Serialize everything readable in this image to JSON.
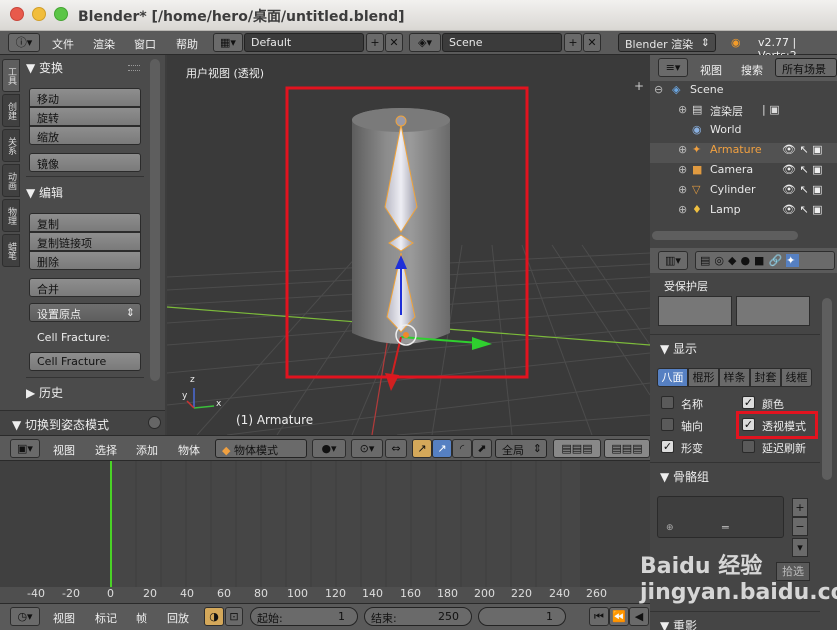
{
  "window": {
    "title": "Blender* [/home/hero/桌面/untitled.blend]"
  },
  "topbar": {
    "menus": [
      "文件",
      "渲染",
      "窗口",
      "帮助"
    ],
    "layout": "Default",
    "scene": "Scene",
    "engine": "Blender 渲染",
    "version": "v2.77 | Verts:2"
  },
  "toolshelf": {
    "tabs": [
      "工具",
      "创建",
      "关系",
      "动画",
      "物理",
      "蜡笔"
    ],
    "transform": {
      "title": "变换",
      "buttons": [
        "移动",
        "旋转",
        "缩放"
      ],
      "mirror": "镜像"
    },
    "edit": {
      "title": "编辑",
      "buttons": [
        "复制",
        "复制链接项",
        "删除"
      ],
      "join": "合并",
      "origin": "设置原点",
      "fracture_label": "Cell Fracture:",
      "fracture_btn": "Cell Fracture"
    },
    "history": {
      "title": "历史"
    },
    "operator": "切换到姿态模式"
  },
  "viewport": {
    "label": "用户视图 (透视)",
    "object": "(1) Armature",
    "axis_x": "x",
    "axis_y": "y",
    "axis_z": "z"
  },
  "viewheader": {
    "menus": [
      "视图",
      "选择",
      "添加",
      "物体"
    ],
    "mode": "物体模式",
    "pivot": "全局"
  },
  "timeline": {
    "ticks": [
      "-40",
      "-20",
      "0",
      "20",
      "40",
      "60",
      "80",
      "100",
      "120",
      "140",
      "160",
      "180",
      "200",
      "220",
      "240",
      "260"
    ],
    "footer_menus": [
      "视图",
      "标记",
      "帧",
      "回放"
    ],
    "start_label": "起始:",
    "start": "1",
    "end_label": "结束:",
    "end": "250",
    "current": "1"
  },
  "outliner": {
    "menus": [
      "视图",
      "搜索"
    ],
    "filter": "所有场景",
    "items": [
      {
        "name": "Scene"
      },
      {
        "name": "渲染层"
      },
      {
        "name": "World"
      },
      {
        "name": "Armature"
      },
      {
        "name": "Camera"
      },
      {
        "name": "Cylinder"
      },
      {
        "name": "Lamp"
      }
    ]
  },
  "properties": {
    "protected": "受保护层",
    "display": {
      "title": "显示",
      "tabs": [
        "八面",
        "棍形",
        "样条",
        "封套",
        "线框"
      ],
      "name": "名称",
      "color": "颜色",
      "axes": "轴向",
      "xray": "透视模式",
      "shape": "形变",
      "delay": "延迟刷新"
    },
    "bonegroups": {
      "title": "骨骼组"
    },
    "select": "拾选",
    "pose": "重影"
  },
  "colors": {
    "accent": "#5680c2",
    "highlight": "#e2131f",
    "frame_line": "#4ad326"
  },
  "watermark": "Baidu 经验 jingyan.baidu.com"
}
